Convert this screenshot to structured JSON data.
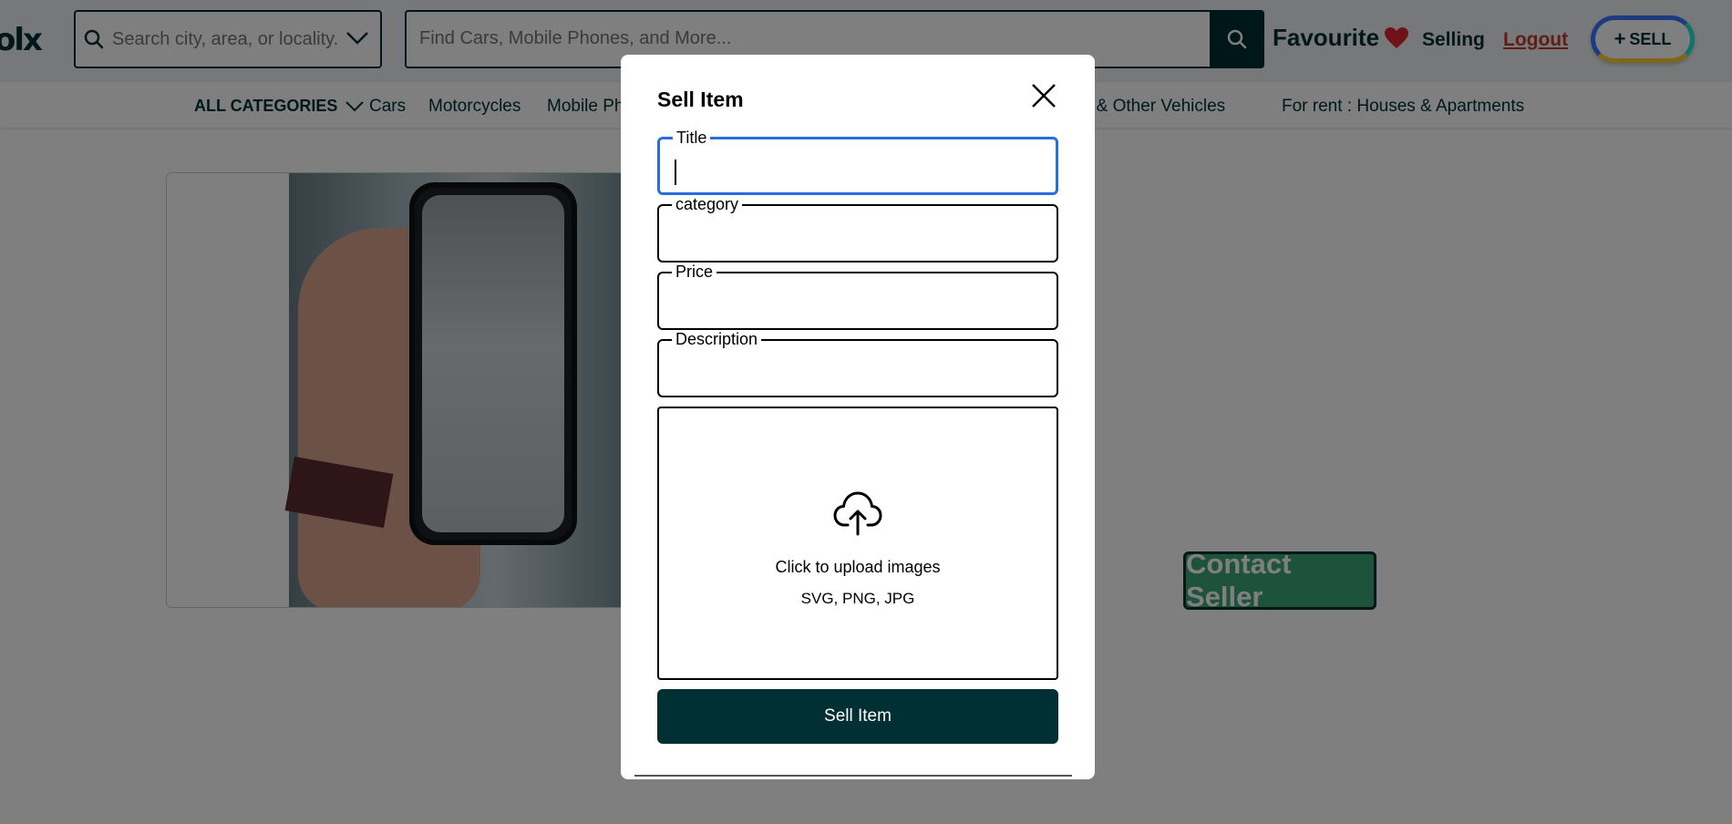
{
  "header": {
    "logo": "olx",
    "location_placeholder": "Search city, area, or locality...",
    "search_placeholder": "Find Cars, Mobile Phones, and More...",
    "favourite_label": "Favourite",
    "selling_label": "Selling",
    "logout_label": "Logout",
    "sell_label": "SELL"
  },
  "categories": {
    "all_label": "ALL CATEGORIES",
    "items": [
      "Cars",
      "Motorcycles",
      "Mobile Phones",
      "Commercial & Other Vehicles",
      "For rent : Houses & Apartments"
    ]
  },
  "product": {
    "contact_label": "Contact Seller"
  },
  "modal": {
    "title": "Sell Item",
    "fields": [
      {
        "label": "Title",
        "value": ""
      },
      {
        "label": "category",
        "value": ""
      },
      {
        "label": "Price",
        "value": ""
      },
      {
        "label": "Description",
        "value": ""
      }
    ],
    "upload_text": "Click to upload images",
    "upload_formats": "SVG, PNG, JPG",
    "submit_label": "Sell Item"
  },
  "colors": {
    "brand": "#002f34",
    "focus": "#2b6cdf",
    "contact": "#3aa777",
    "heart": "#e0252f",
    "logout": "#c0392b"
  }
}
